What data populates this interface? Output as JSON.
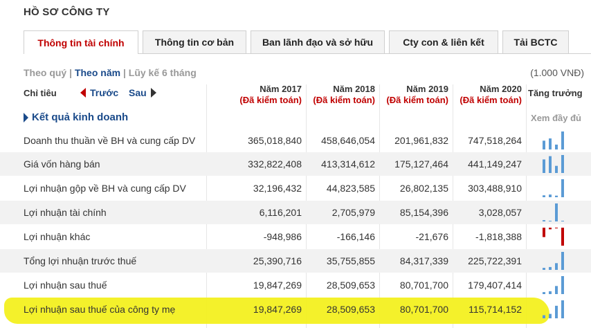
{
  "page": {
    "title": "HỒ SƠ CÔNG TY"
  },
  "tabs": [
    {
      "label": "Thông tin tài chính",
      "active": true
    },
    {
      "label": "Thông tin cơ bản",
      "active": false
    },
    {
      "label": "Ban lãnh đạo và sở hữu",
      "active": false
    },
    {
      "label": "Cty con & liên kết",
      "active": false
    },
    {
      "label": "Tải BCTC",
      "active": false
    }
  ],
  "period": {
    "quarter": "Theo quý",
    "year": "Theo năm",
    "sep": "|",
    "cumulative": "Lũy kế 6 tháng",
    "selected": "Theo năm"
  },
  "unit": "(1.000 VNĐ)",
  "header": {
    "indicator": "Chỉ tiêu",
    "prev": "Trước",
    "next": "Sau",
    "growth": "Tăng trưởng",
    "years": [
      {
        "year": "Năm 2017",
        "audit": "(Đã kiểm toán)"
      },
      {
        "year": "Năm 2018",
        "audit": "(Đã kiểm toán)"
      },
      {
        "year": "Năm 2019",
        "audit": "(Đã kiểm toán)"
      },
      {
        "year": "Năm 2020",
        "audit": "(Đã kiểm toán)"
      }
    ]
  },
  "section": {
    "label": "Kết quả kinh doanh",
    "view_all": "Xem đầy đủ"
  },
  "rows": [
    {
      "name": "Doanh thu thuần về BH và cung cấp DV",
      "values": [
        "365,018,840",
        "458,646,054",
        "201,961,832",
        "747,518,264"
      ],
      "numbers": [
        365018840,
        458646054,
        201961832,
        747518264
      ]
    },
    {
      "name": "Giá vốn hàng bán",
      "values": [
        "332,822,408",
        "413,314,612",
        "175,127,464",
        "441,149,247"
      ],
      "numbers": [
        332822408,
        413314612,
        175127464,
        441149247
      ]
    },
    {
      "name": "Lợi nhuận gộp về BH và cung cấp DV",
      "values": [
        "32,196,432",
        "44,823,585",
        "26,802,135",
        "303,488,910"
      ],
      "numbers": [
        32196432,
        44823585,
        26802135,
        303488910
      ]
    },
    {
      "name": "Lợi nhuận tài chính",
      "values": [
        "6,116,201",
        "2,705,979",
        "85,154,396",
        "3,028,057"
      ],
      "numbers": [
        6116201,
        2705979,
        85154396,
        3028057
      ]
    },
    {
      "name": "Lợi nhuận khác",
      "values": [
        "-948,986",
        "-166,146",
        "-21,676",
        "-1,818,388"
      ],
      "numbers": [
        -948986,
        -166146,
        -21676,
        -1818388
      ]
    },
    {
      "name": "Tổng lợi nhuận trước thuế",
      "values": [
        "25,390,716",
        "35,755,855",
        "84,317,339",
        "225,722,391"
      ],
      "numbers": [
        25390716,
        35755855,
        84317339,
        225722391
      ]
    },
    {
      "name": "Lợi nhuận sau thuế",
      "values": [
        "19,847,269",
        "28,509,653",
        "80,701,700",
        "179,407,414"
      ],
      "numbers": [
        19847269,
        28509653,
        80701700,
        179407414
      ]
    },
    {
      "name": "Lợi nhuận sau thuế của công ty mẹ",
      "values": [
        "19,847,269",
        "28,509,653",
        "80,701,700",
        "115,714,152"
      ],
      "numbers": [
        19847269,
        28509653,
        80701700,
        115714152
      ]
    }
  ],
  "colors": {
    "accent_red": "#c00000",
    "link_blue": "#1a4a8a",
    "spark_blue": "#5b9bd5",
    "spark_red": "#c00000",
    "highlight": "#f3f020"
  }
}
